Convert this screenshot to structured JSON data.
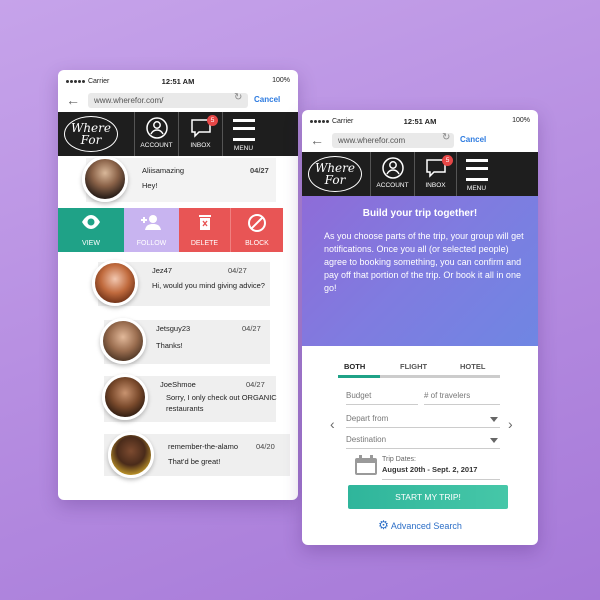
{
  "colors": {
    "accent_teal": "#1fa287",
    "follow_purple": "#c8b4f0",
    "danger_red": "#e85555",
    "link_blue": "#2d7be0",
    "nav_dark": "#1e1e1e"
  },
  "status_bar": {
    "carrier": "Carrier",
    "time": "12:51 AM",
    "battery": "100%"
  },
  "browser": {
    "url_left": "www.wherefor.com/",
    "url_right": "www.wherefor.com",
    "cancel": "Cancel"
  },
  "nav": {
    "logo_text": "Where For",
    "account": "ACCOUNT",
    "inbox": "INBOX",
    "inbox_badge": "5",
    "menu": "MENU"
  },
  "inbox_screen": {
    "messages": [
      {
        "name": "Aliisamazing",
        "date": "04/27",
        "text": "Hey!"
      },
      {
        "name": "Jez47",
        "date": "04/27",
        "text": "Hi, would you mind giving advice?"
      },
      {
        "name": "Jetsguy23",
        "date": "04/27",
        "text": "Thanks!"
      },
      {
        "name": "JoeShmoe",
        "date": "04/27",
        "text": "Sorry, I only check out ORGANIC restaurants"
      },
      {
        "name": "remember-the-alamo",
        "date": "04/20",
        "text": "That'd be great!"
      }
    ],
    "actions": {
      "view": "VIEW",
      "follow": "FOLLOW",
      "delete": "DELETE",
      "block": "BLOCK"
    }
  },
  "trip_screen": {
    "hero_title": "Build your trip together!",
    "hero_text": "As you choose parts of the trip, your group will get notifications. Once  you all (or selected people) agree to booking something, you can  confirm and pay off that portion of the trip. Or book it all in one go!",
    "tabs": [
      "BOTH",
      "FLIGHT",
      "HOTEL"
    ],
    "active_tab": "BOTH",
    "budget_placeholder": "Budget",
    "travelers_placeholder": "# of travelers",
    "depart_placeholder": "Depart from",
    "destination_placeholder": "Destination",
    "trip_dates_label": "Trip Dates:",
    "trip_dates_value": "August 20th - Sept. 2, 2017",
    "start_button": "START MY TRIP!",
    "advanced_search": "Advanced  Search"
  }
}
